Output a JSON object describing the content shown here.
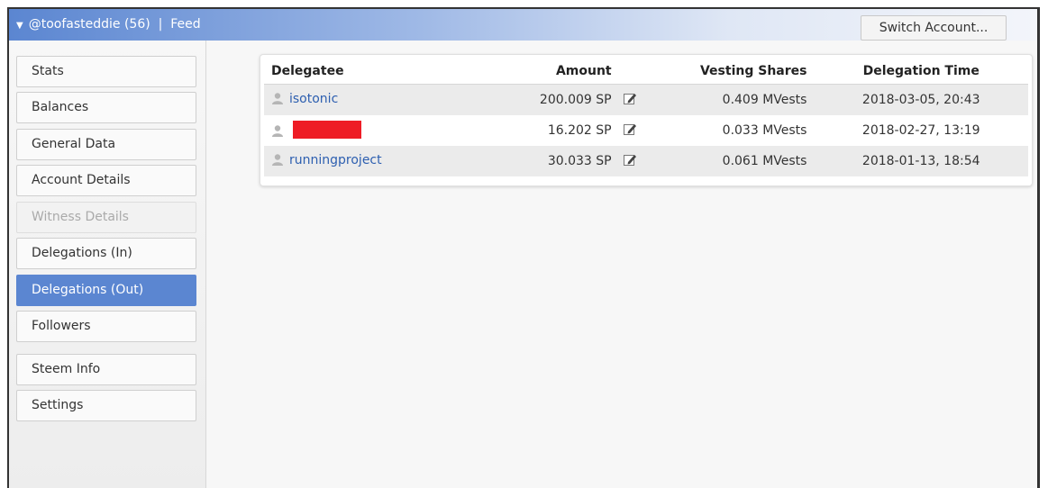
{
  "header": {
    "account_title": "@toofasteddie (56)  |  Feed",
    "switch_label": "Switch Account..."
  },
  "sidebar": {
    "items": [
      {
        "label": "Stats",
        "state": "normal"
      },
      {
        "label": "Balances",
        "state": "normal"
      },
      {
        "label": "General Data",
        "state": "normal"
      },
      {
        "label": "Account Details",
        "state": "normal"
      },
      {
        "label": "Witness Details",
        "state": "disabled"
      },
      {
        "label": "Delegations (In)",
        "state": "normal"
      },
      {
        "label": "Delegations (Out)",
        "state": "active"
      },
      {
        "label": "Followers",
        "state": "normal"
      },
      {
        "label": "Steem Info",
        "state": "normal"
      },
      {
        "label": "Settings",
        "state": "normal"
      }
    ]
  },
  "delegations": {
    "columns": [
      "Delegatee",
      "Amount",
      "",
      "Vesting Shares",
      "Delegation Time"
    ],
    "rows": [
      {
        "delegatee": "isotonic",
        "amount": "200.009 SP",
        "vesting": "0.409 MVests",
        "time": "2018-03-05, 20:43",
        "redacted": false
      },
      {
        "delegatee": "",
        "amount": "16.202 SP",
        "vesting": "0.033 MVests",
        "time": "2018-02-27, 13:19",
        "redacted": true
      },
      {
        "delegatee": "runningproject",
        "amount": "30.033 SP",
        "vesting": "0.061 MVests",
        "time": "2018-01-13, 18:54",
        "redacted": false
      }
    ]
  },
  "icons": {
    "title_toggle": "caret-down-icon",
    "row_avatar": "user-silhouette-icon",
    "row_edit": "edit-pencil-icon"
  },
  "colors": {
    "accent": "#5b86d1",
    "link": "#2d5fb0",
    "redaction": "#ee1c25"
  }
}
